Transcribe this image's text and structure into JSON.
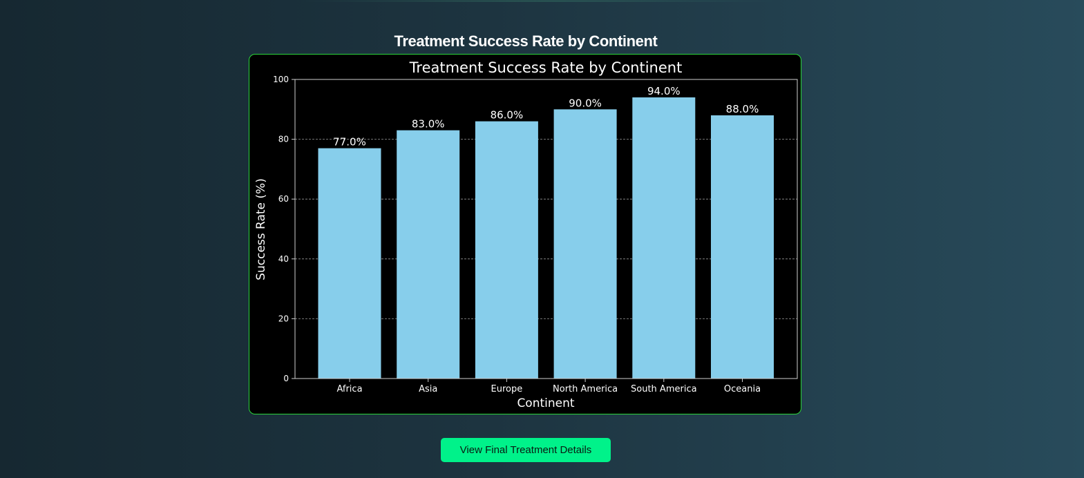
{
  "page": {
    "title": "Treatment Success Rate by Continent"
  },
  "button": {
    "label": "View Final Treatment Details"
  },
  "colors": {
    "bar": "#87ceeb",
    "frame_border": "#2bd63a",
    "button_bg": "#00f28a",
    "chart_bg": "#000000"
  },
  "chart_data": {
    "type": "bar",
    "title": "Treatment Success Rate by Continent",
    "xlabel": "Continent",
    "ylabel": "Success Rate (%)",
    "categories": [
      "Africa",
      "Asia",
      "Europe",
      "North America",
      "South America",
      "Oceania"
    ],
    "values": [
      77,
      83,
      86,
      90,
      94,
      88
    ],
    "value_labels": [
      "77.0%",
      "83.0%",
      "86.0%",
      "90.0%",
      "94.0%",
      "88.0%"
    ],
    "ylim": [
      0,
      100
    ],
    "yticks": [
      0,
      20,
      40,
      60,
      80,
      100
    ],
    "grid": "y-axis dashed",
    "legend": "none"
  }
}
